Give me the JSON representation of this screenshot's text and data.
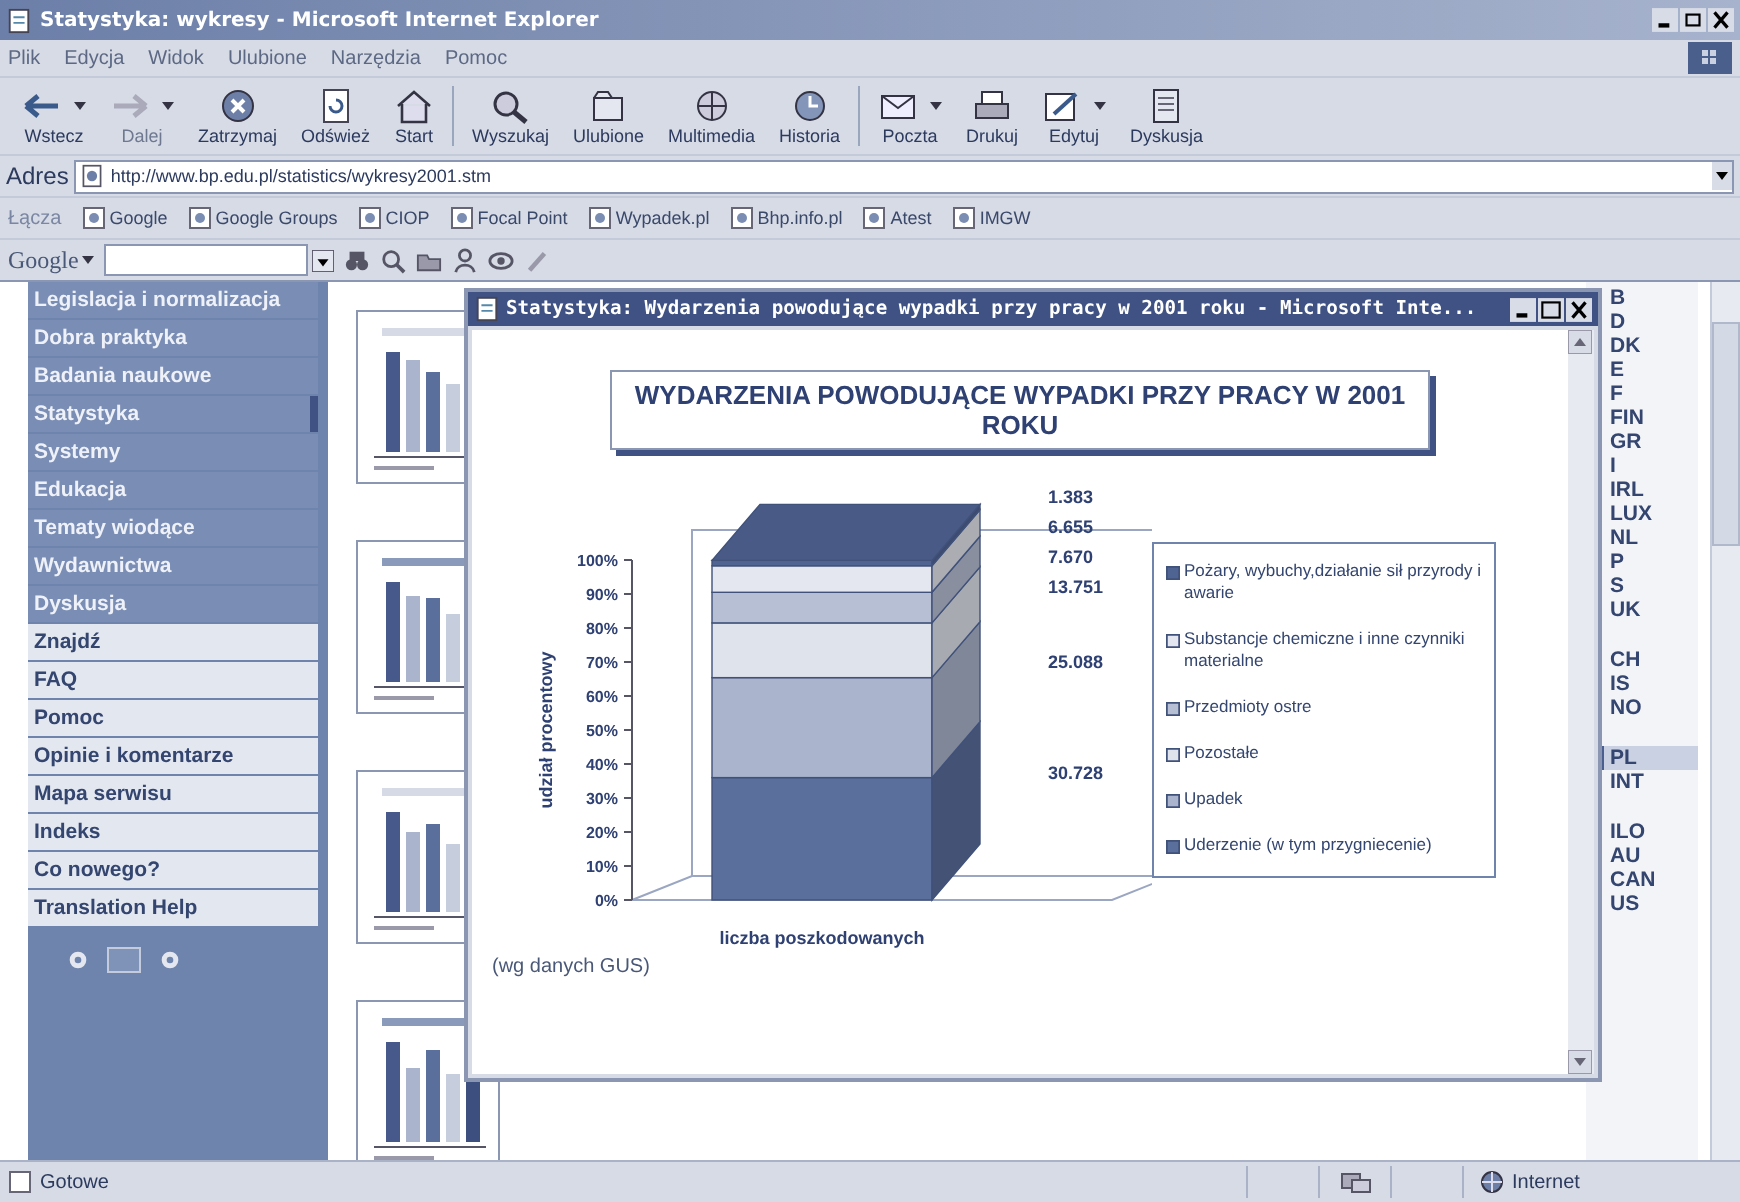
{
  "window": {
    "title": "Statystyka: wykresy - Microsoft Internet Explorer"
  },
  "menu": [
    "Plik",
    "Edycja",
    "Widok",
    "Ulubione",
    "Narzędzia",
    "Pomoc"
  ],
  "toolbar": [
    {
      "label": "Wstecz",
      "kind": "back",
      "dropdown": true,
      "disabled": false
    },
    {
      "label": "Dalej",
      "kind": "forward",
      "dropdown": true,
      "disabled": true
    },
    {
      "label": "Zatrzymaj",
      "kind": "stop",
      "dropdown": false,
      "disabled": false
    },
    {
      "label": "Odśwież",
      "kind": "refresh",
      "dropdown": false,
      "disabled": false
    },
    {
      "label": "Start",
      "kind": "home",
      "dropdown": false,
      "disabled": false
    },
    {
      "kind": "separator"
    },
    {
      "label": "Wyszukaj",
      "kind": "search",
      "dropdown": false,
      "disabled": false
    },
    {
      "label": "Ulubione",
      "kind": "favorites",
      "dropdown": false,
      "disabled": false
    },
    {
      "label": "Multimedia",
      "kind": "media",
      "dropdown": false,
      "disabled": false
    },
    {
      "label": "Historia",
      "kind": "history",
      "dropdown": false,
      "disabled": false
    },
    {
      "kind": "separator"
    },
    {
      "label": "Poczta",
      "kind": "mail",
      "dropdown": true,
      "disabled": false
    },
    {
      "label": "Drukuj",
      "kind": "print",
      "dropdown": false,
      "disabled": false
    },
    {
      "label": "Edytuj",
      "kind": "edit",
      "dropdown": true,
      "disabled": false
    },
    {
      "label": "Dyskusja",
      "kind": "discuss",
      "dropdown": false,
      "disabled": false
    }
  ],
  "address": {
    "label": "Adres",
    "value": "http://www.bp.edu.pl/statistics/wykresy2001.stm"
  },
  "links": {
    "label": "Łącza",
    "items": [
      "Google",
      "Google Groups",
      "CIOP",
      "Focal Point",
      "Wypadek.pl",
      "Bhp.info.pl",
      "Atest",
      "IMGW"
    ]
  },
  "google_toolbar": {
    "logo": "Google"
  },
  "sidebar": {
    "items": [
      {
        "label": "Legislacja i normalizacja",
        "kind": "primary",
        "selected": false
      },
      {
        "label": "Dobra praktyka",
        "kind": "primary",
        "selected": false
      },
      {
        "label": "Badania naukowe",
        "kind": "primary",
        "selected": false
      },
      {
        "label": "Statystyka",
        "kind": "primary",
        "selected": true
      },
      {
        "label": "Systemy",
        "kind": "primary",
        "selected": false
      },
      {
        "label": "Edukacja",
        "kind": "primary",
        "selected": false
      },
      {
        "label": "Tematy wiodące",
        "kind": "primary",
        "selected": false
      },
      {
        "label": "Wydawnictwa",
        "kind": "primary",
        "selected": false
      },
      {
        "label": "Dyskusja",
        "kind": "primary",
        "selected": false
      },
      {
        "label": "Znajdź",
        "kind": "secondary",
        "selected": false
      },
      {
        "label": "FAQ",
        "kind": "secondary",
        "selected": false
      },
      {
        "label": "Pomoc",
        "kind": "secondary",
        "selected": false
      },
      {
        "label": "Opinie i komentarze",
        "kind": "secondary",
        "selected": false
      },
      {
        "label": "Mapa serwisu",
        "kind": "secondary",
        "selected": false
      },
      {
        "label": "Indeks",
        "kind": "secondary",
        "selected": false
      },
      {
        "label": "Co nowego?",
        "kind": "secondary",
        "selected": false
      },
      {
        "label": "Translation Help",
        "kind": "secondary",
        "selected": false
      }
    ]
  },
  "thumbnails": [
    {
      "kind": "picture"
    },
    {
      "kind": "picture"
    },
    {
      "kind": "picture"
    },
    {
      "kind": "picture"
    }
  ],
  "countries": [
    [
      {
        "label": "B",
        "selected": false
      },
      {
        "label": "D",
        "selected": false
      },
      {
        "label": "DK",
        "selected": false
      },
      {
        "label": "E",
        "selected": false
      },
      {
        "label": "F",
        "selected": false
      },
      {
        "label": "FIN",
        "selected": false
      },
      {
        "label": "GR",
        "selected": false
      },
      {
        "label": "I",
        "selected": false
      },
      {
        "label": "IRL",
        "selected": false
      },
      {
        "label": "LUX",
        "selected": false
      },
      {
        "label": "NL",
        "selected": false
      },
      {
        "label": "P",
        "selected": false
      },
      {
        "label": "S",
        "selected": false
      },
      {
        "label": "UK",
        "selected": false
      }
    ],
    [
      {
        "label": "CH",
        "selected": false
      },
      {
        "label": "IS",
        "selected": false
      },
      {
        "label": "NO",
        "selected": false
      }
    ],
    [
      {
        "label": "PL",
        "selected": true
      },
      {
        "label": "INT",
        "selected": false
      }
    ],
    [
      {
        "label": "ILO",
        "selected": false
      },
      {
        "label": "AU",
        "selected": false
      },
      {
        "label": "CAN",
        "selected": false
      },
      {
        "label": "US",
        "selected": false
      }
    ]
  ],
  "popup": {
    "title": "Statystyka: Wydarzenia powodujące wypadki przy pracy w 2001 roku - Microsoft Inte...",
    "chart_data": {
      "type": "bar",
      "title": "WYDARZENIA POWODUJĄCE WYPADKI PRZY PRACY W 2001 ROKU",
      "xlabel": "liczba poszkodowanych",
      "ylabel": "udział procentowy",
      "categories": [
        null
      ],
      "stacked": true,
      "ylim": [
        0,
        100
      ],
      "legend": "right",
      "yticks": [
        {
          "value": 0,
          "label": "0%"
        },
        {
          "value": 10,
          "label": "10%"
        },
        {
          "value": 20,
          "label": "20%"
        },
        {
          "value": 30,
          "label": "30%"
        },
        {
          "value": 40,
          "label": "40%"
        },
        {
          "value": 50,
          "label": "50%"
        },
        {
          "value": 60,
          "label": "60%"
        },
        {
          "value": 70,
          "label": "70%"
        },
        {
          "value": 80,
          "label": "80%"
        },
        {
          "value": 90,
          "label": "90%"
        },
        {
          "value": 100,
          "label": "100%"
        }
      ],
      "series": [
        {
          "name": "Uderzenie (w tym przygniecenie)",
          "color": "#5a6f9c",
          "values": [
            36.0
          ]
        },
        {
          "name": "Upadek",
          "color": "#aab4cc",
          "values": [
            29.4
          ]
        },
        {
          "name": "Pozostałe",
          "color": "#dfe3ec",
          "values": [
            16.1
          ]
        },
        {
          "name": "Przedmioty ostre",
          "color": "#b6bfd4",
          "values": [
            9.0
          ]
        },
        {
          "name": "Substancje chemiczne i inne czynniki materialne",
          "color": "#e4e7ef",
          "values": [
            7.8
          ]
        },
        {
          "name": "Pożary, wybuchy,działanie sił przyrody i awarie",
          "color": "#506494",
          "values": [
            1.6
          ]
        }
      ],
      "value_labels": [
        "30.728",
        "25.088",
        "13.751",
        "7.670",
        "6.655",
        "1.383"
      ]
    },
    "source": "(wg danych GUS)"
  },
  "status_bar": {
    "text": "Gotowe",
    "zone": "Internet"
  }
}
